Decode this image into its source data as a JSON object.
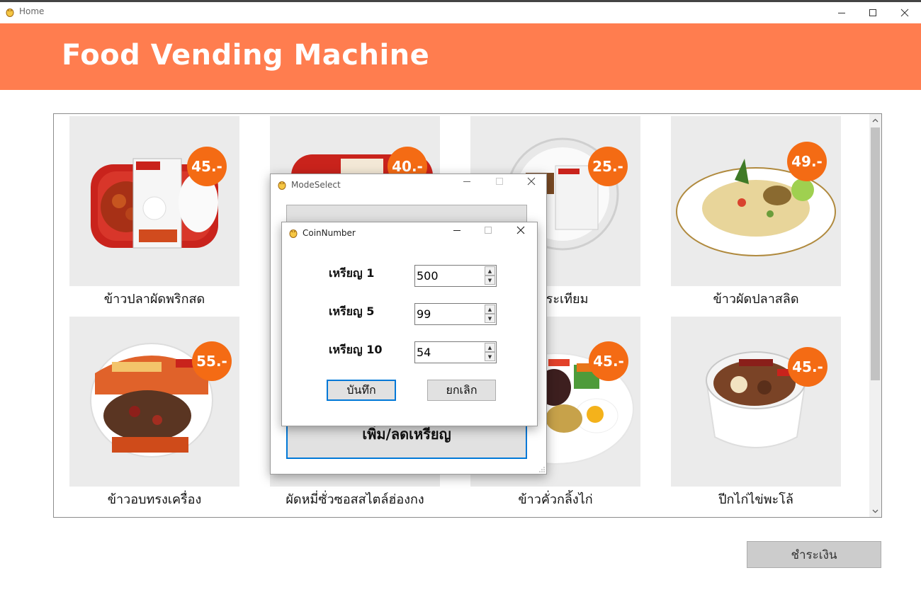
{
  "window": {
    "title": "Home"
  },
  "header": {
    "title": "Food Vending Machine"
  },
  "colors": {
    "accent": "#ff7d4f",
    "price_badge": "#f46b14",
    "focus": "#0078d7"
  },
  "menu": {
    "items": [
      {
        "name": "ข้าวปลาผัดพริกสด",
        "price": "45.-"
      },
      {
        "name": "",
        "price": "40.-"
      },
      {
        "name": "ผัดกระเทียม",
        "price": "25.-"
      },
      {
        "name": "ข้าวผัดปลาสลิด",
        "price": "49.-"
      },
      {
        "name": "ข้าวอบทรงเครื่อง",
        "price": "55.-"
      },
      {
        "name": "ผัดหมี่ซั่วซอสสไตล์ฮ่องกง",
        "price": ""
      },
      {
        "name": "ข้าวคั่วกลิ้งไก่",
        "price": "45.-"
      },
      {
        "name": "ปีกไก่ไข่พะโล้",
        "price": "45.-"
      }
    ]
  },
  "pay_button": {
    "label": "ชำระเงิน"
  },
  "mode_dialog": {
    "title": "ModeSelect",
    "coin_button": "เพิ่ม/ลดเหรียญ"
  },
  "coin_dialog": {
    "title": "CoinNumber",
    "rows": [
      {
        "label": "เหรียญ 1",
        "value": "500"
      },
      {
        "label": "เหรียญ 5",
        "value": "99"
      },
      {
        "label": "เหรียญ 10",
        "value": "54"
      }
    ],
    "save_label": "บันทึก",
    "cancel_label": "ยกเลิก"
  }
}
